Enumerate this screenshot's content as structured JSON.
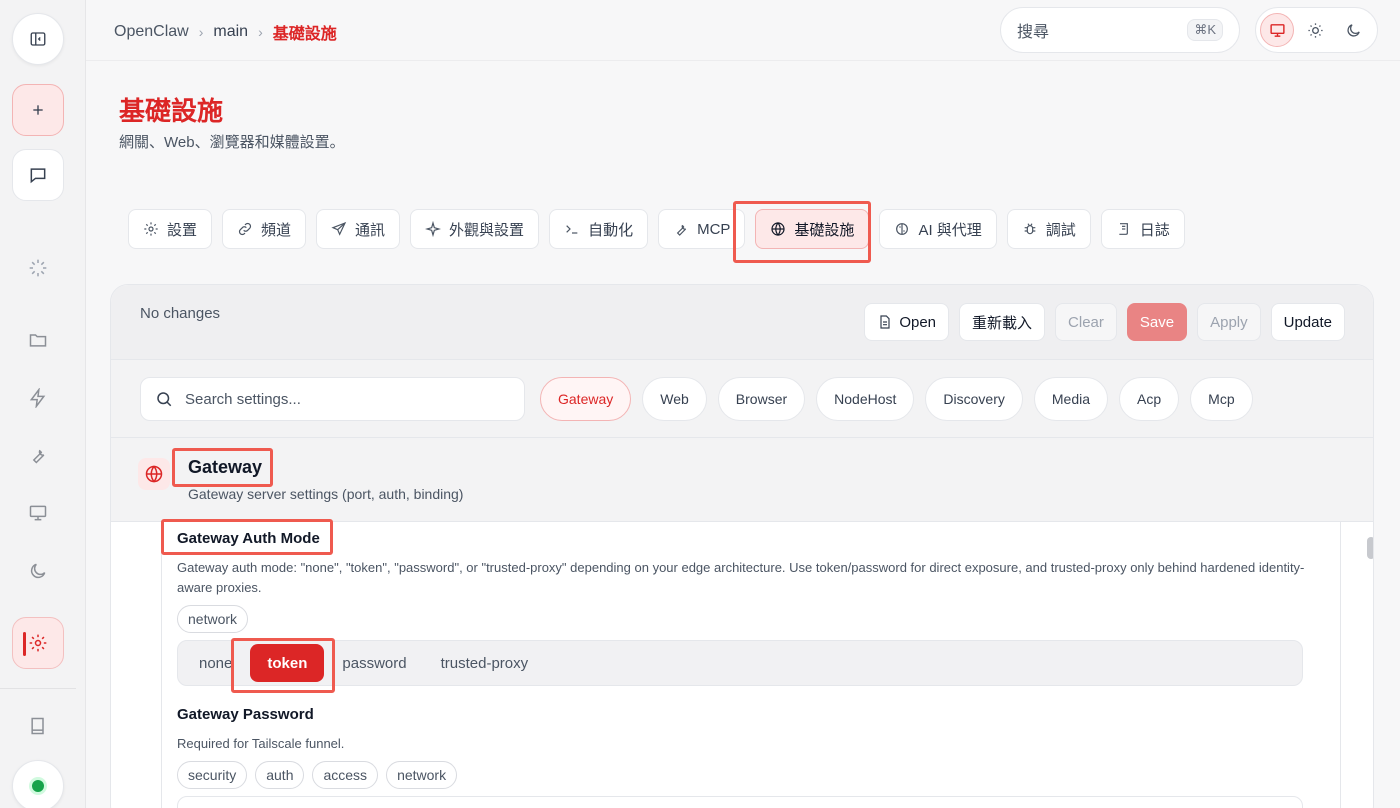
{
  "breadcrumb": {
    "root": "OpenClaw",
    "sep": "›",
    "mid": "main",
    "current": "基礎設施"
  },
  "search": {
    "label": "搜尋",
    "shortcut": "⌘K"
  },
  "theme": {
    "options": [
      "monitor-icon",
      "sun-icon",
      "moon-icon"
    ],
    "selected": "monitor-icon"
  },
  "sidebar": {
    "items": [
      "sidebar-toggle-icon",
      "plus-icon",
      "chat-icon",
      "loader-icon",
      "folder-icon",
      "bolt-icon",
      "wrench-icon",
      "monitor-icon",
      "moon-icon",
      "gear-icon",
      "book-icon",
      "status-dot"
    ],
    "active": "gear-icon"
  },
  "page": {
    "title": "基礎設施",
    "subtitle": "網關、Web、瀏覽器和媒體設置。"
  },
  "tabs": [
    {
      "label": "設置",
      "icon": "gear-icon"
    },
    {
      "label": "頻道",
      "icon": "link-icon"
    },
    {
      "label": "通訊",
      "icon": "send-icon"
    },
    {
      "label": "外觀與設置",
      "icon": "sparkle-icon"
    },
    {
      "label": "自動化",
      "icon": "terminal-icon"
    },
    {
      "label": "MCP",
      "icon": "wrench-icon"
    },
    {
      "label": "基礎設施",
      "icon": "globe-icon",
      "active": true
    },
    {
      "label": "AI 與代理",
      "icon": "brain-icon"
    },
    {
      "label": "調試",
      "icon": "bug-icon"
    },
    {
      "label": "日誌",
      "icon": "scroll-icon"
    }
  ],
  "toolbar": {
    "status": "No changes",
    "open_label": "Open",
    "reload_label": "重新載入",
    "clear_label": "Clear",
    "save_label": "Save",
    "apply_label": "Apply",
    "update_label": "Update"
  },
  "filter": {
    "placeholder": "Search settings...",
    "chips": [
      "Gateway",
      "Web",
      "Browser",
      "NodeHost",
      "Discovery",
      "Media",
      "Acp",
      "Mcp"
    ],
    "active": "Gateway"
  },
  "section": {
    "title": "Gateway",
    "description": "Gateway server settings (port, auth, binding)",
    "icon": "globe-icon"
  },
  "fields": {
    "auth_mode": {
      "title": "Gateway Auth Mode",
      "description": "Gateway auth mode: \"none\", \"token\", \"password\", or \"trusted-proxy\" depending on your edge architecture. Use token/password for direct exposure, and trusted-proxy only behind hardened identity-aware proxies.",
      "tags": [
        "network"
      ],
      "options": [
        "none",
        "token",
        "password",
        "trusted-proxy"
      ],
      "selected": "token"
    },
    "password": {
      "title": "Gateway Password",
      "description": "Required for Tailscale funnel.",
      "tags": [
        "security",
        "auth",
        "access",
        "network"
      ]
    }
  },
  "colors": {
    "accent": "#dc2626",
    "highlight": "#ef5a4f",
    "save_bg": "#e98484"
  }
}
